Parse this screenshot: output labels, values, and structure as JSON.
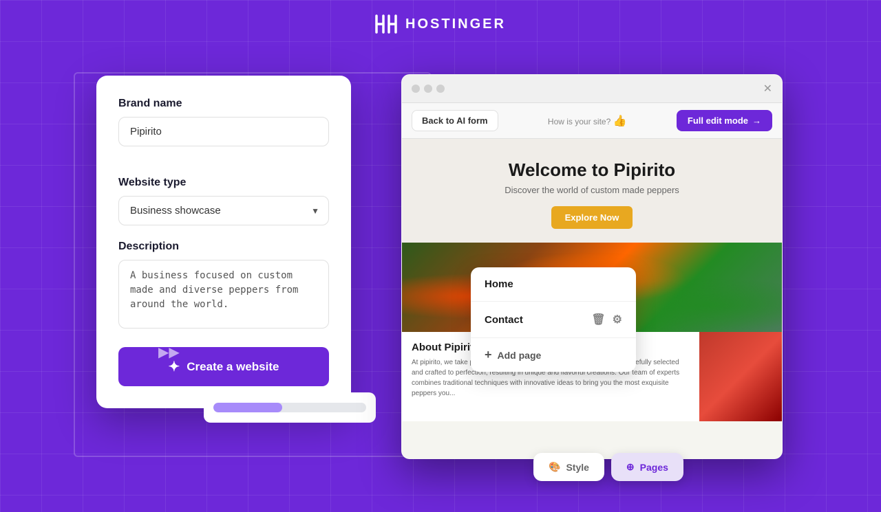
{
  "app": {
    "logo_text": "HOSTINGER"
  },
  "form": {
    "brand_label": "Brand name",
    "brand_value": "Pipirito",
    "website_type_label": "Website type",
    "website_type_value": "Business showcase",
    "description_label": "Description",
    "description_value": "A business focused on custom made and diverse peppers from around the world.",
    "create_btn_label": "Create a website"
  },
  "browser": {
    "back_btn": "Back to AI form",
    "how_site": "How is your site?",
    "full_edit_btn": "Full edit mode"
  },
  "preview": {
    "hero_title": "Welcome to Pipirito",
    "hero_subtitle": "Discover the world of custom made peppers",
    "explore_btn": "Explore Now",
    "about_title": "About Pipirito",
    "about_text": "At pipirito, we take pride in our custom made peppers. Each pepper is carefully selected and crafted to perfection, resulting in unique and flavorful creations. Our team of experts combines traditional techniques with innovative ideas to bring you the most exquisite peppers you..."
  },
  "nav_dropdown": {
    "home_label": "Home",
    "contact_label": "Contact",
    "add_page_label": "Add page"
  },
  "tabs": {
    "style_label": "Style",
    "pages_label": "Pages"
  }
}
